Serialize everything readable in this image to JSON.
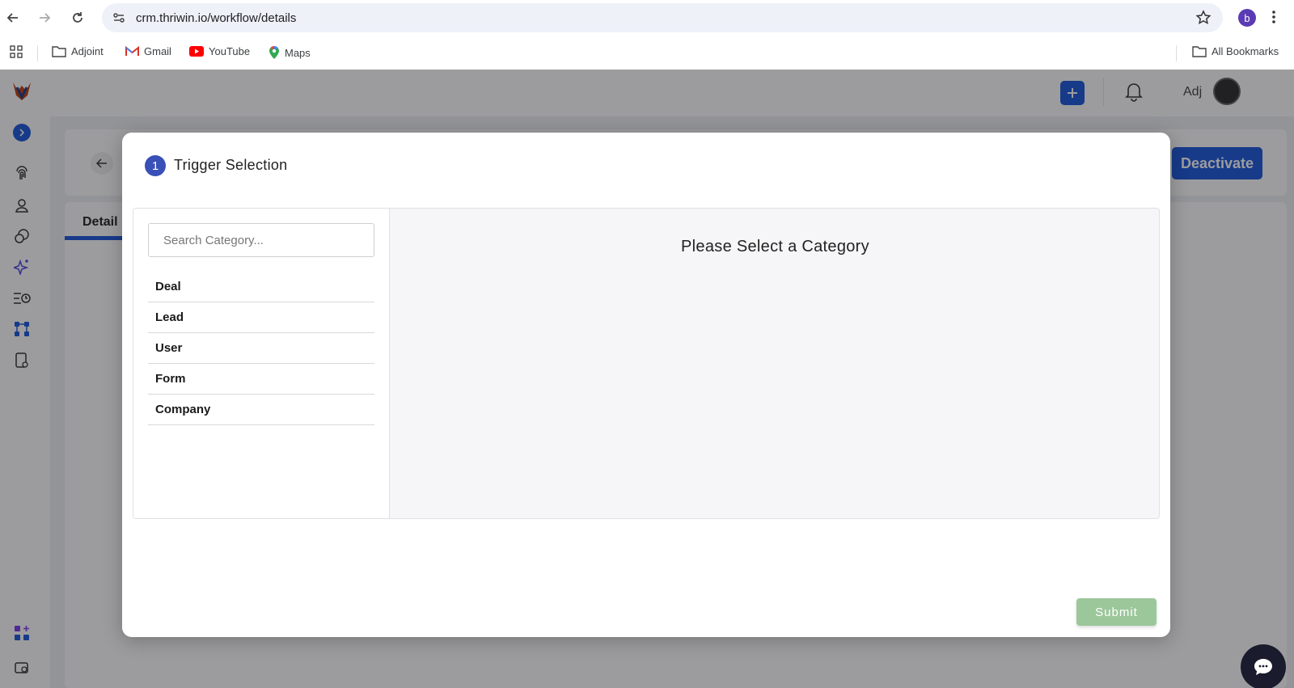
{
  "browser": {
    "url": "crm.thriwin.io/workflow/details",
    "profile_initial": "b",
    "bookmarks": [
      {
        "label": "Adjoint"
      },
      {
        "label": "Gmail"
      },
      {
        "label": "YouTube"
      },
      {
        "label": "Maps"
      }
    ],
    "all_bookmarks_label": "All Bookmarks"
  },
  "app": {
    "user_label": "Adj",
    "background_tab_label": "Detail",
    "background_button_label": "Deactivate",
    "brand_color": "#1a56db"
  },
  "modal": {
    "step_number": "1",
    "title": "Trigger Selection",
    "search_placeholder": "Search Category...",
    "categories": [
      "Deal",
      "Lead",
      "User",
      "Form",
      "Company"
    ],
    "empty_message": "Please Select a Category",
    "submit_label": "Submit",
    "submit_color": "#9cc79b"
  }
}
